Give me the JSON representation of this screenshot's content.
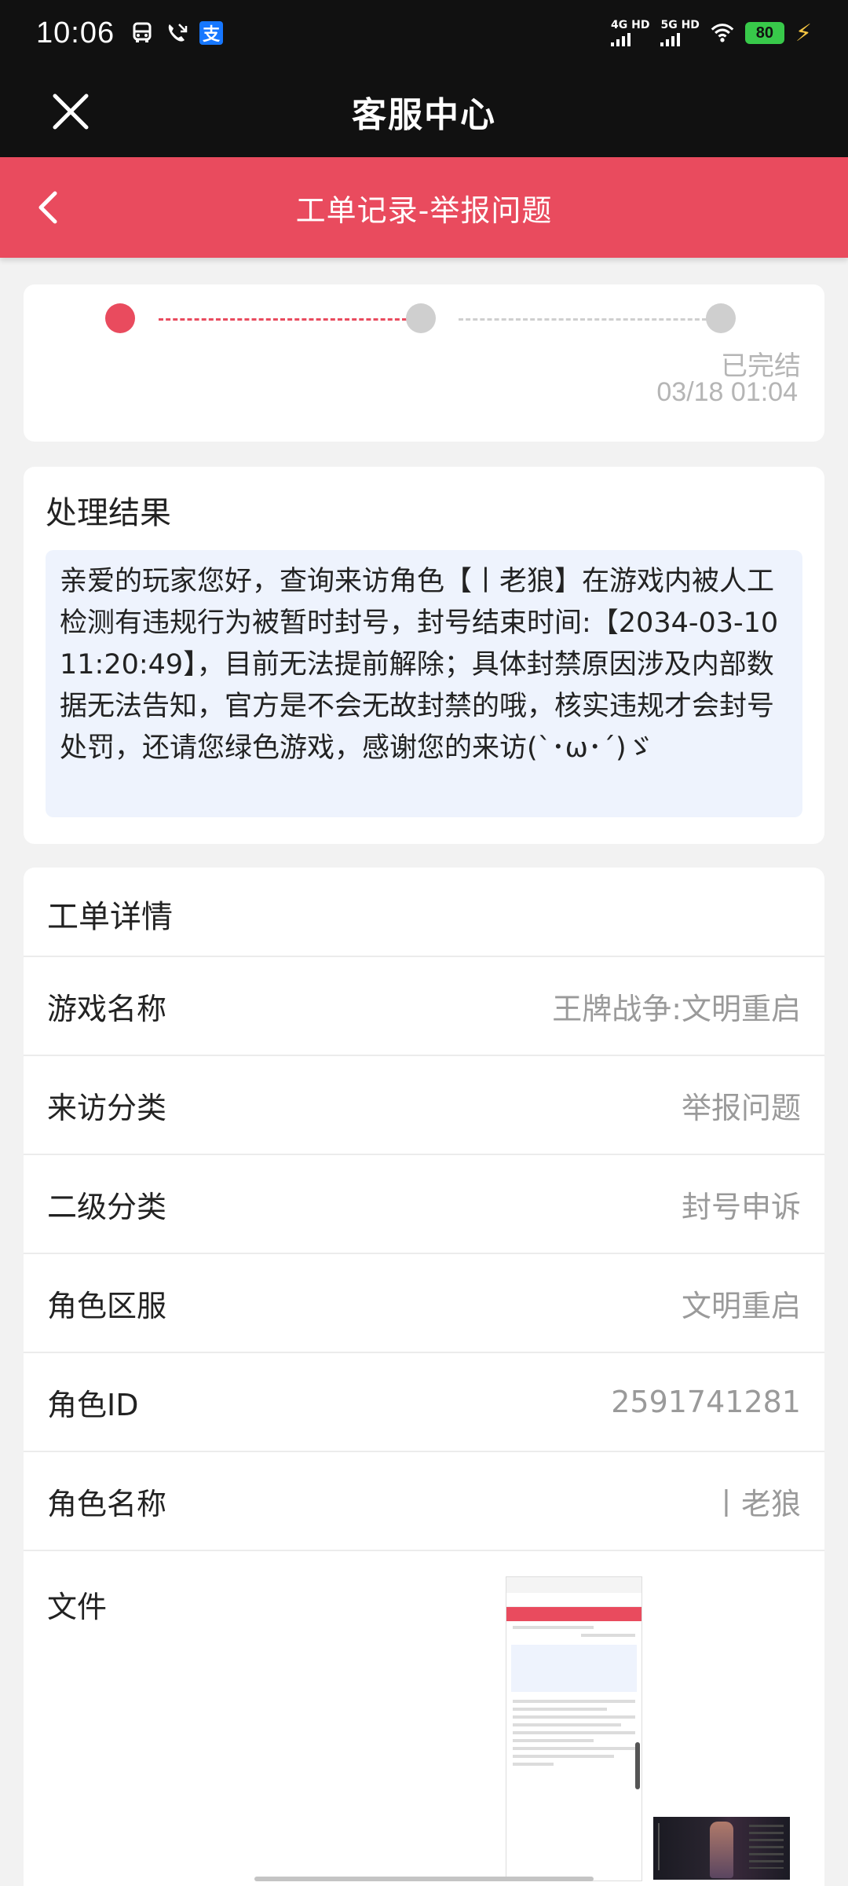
{
  "status_bar": {
    "time": "10:06",
    "network1": "4G HD",
    "network2": "5G HD",
    "battery": "80",
    "alipay_glyph": "支"
  },
  "header": {
    "title": "客服中心"
  },
  "sub_header": {
    "title": "工单记录-举报问题"
  },
  "progress": {
    "final_status": "已完结",
    "final_time": "03/18 01:04"
  },
  "result": {
    "title": "处理结果",
    "text": "亲爱的玩家您好，查询来访角色【丨老狼】在游戏内被人工检测有违规行为被暂时封号，封号结束时间:【2034-03-10 11:20:49】，目前无法提前解除；具体封禁原因涉及内部数据无法告知，官方是不会无故封禁的哦，核实违规才会封号处罚，还请您绿色游戏，感谢您的来访(`･ω･´)ゞ"
  },
  "details": {
    "title": "工单详情",
    "rows": [
      {
        "label": "游戏名称",
        "value": "王牌战争:文明重启"
      },
      {
        "label": "来访分类",
        "value": "举报问题"
      },
      {
        "label": "二级分类",
        "value": "封号申诉"
      },
      {
        "label": "角色区服",
        "value": "文明重启"
      },
      {
        "label": "角色ID",
        "value": "2591741281"
      },
      {
        "label": "角色名称",
        "value": "丨老狼"
      }
    ],
    "file_label": "文件"
  },
  "colors": {
    "accent": "#e94b5e",
    "header_bg": "#111111",
    "result_bg": "#eef3fd"
  }
}
